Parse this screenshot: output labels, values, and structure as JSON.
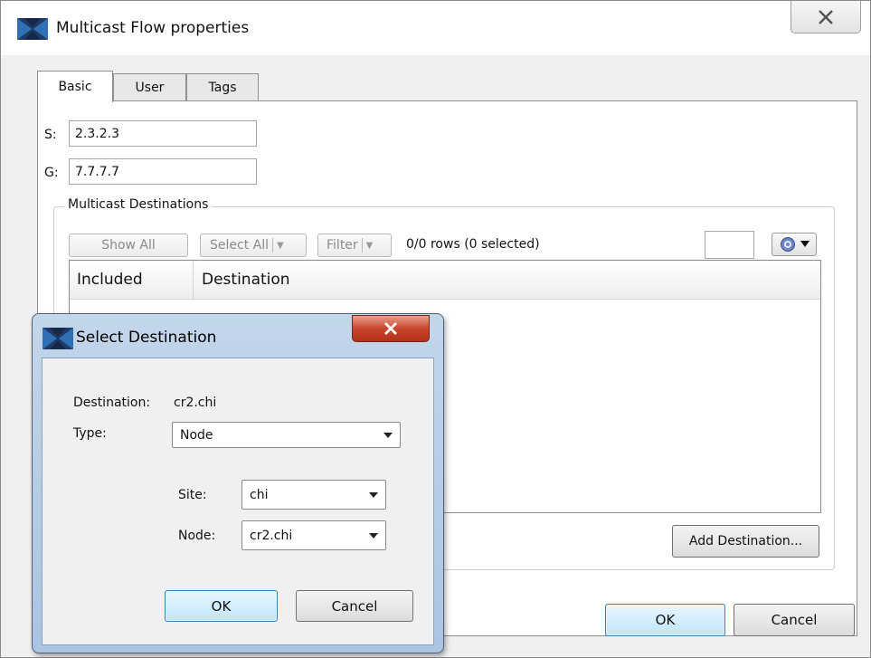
{
  "main_window": {
    "title": "Multicast Flow properties",
    "tabs": [
      "Basic",
      "User",
      "Tags"
    ],
    "s_label": "S:",
    "s_value": "2.3.2.3",
    "g_label": "G:",
    "g_value": "7.7.7.7",
    "group_title": "Multicast Destinations",
    "toolbar": {
      "show_all": "Show All",
      "select_all": "Select All",
      "filter": "Filter",
      "row_status": "0/0 rows (0 selected)"
    },
    "table": {
      "columns": [
        "Included",
        "Destination"
      ],
      "rows": []
    },
    "add_destination": "Add Destination...",
    "ok": "OK",
    "cancel": "Cancel"
  },
  "dialog": {
    "title": "Select Destination",
    "destination_label": "Destination:",
    "destination_value": "cr2.chi",
    "type_label": "Type:",
    "type_value": "Node",
    "site_label": "Site:",
    "site_value": "chi",
    "node_label": "Node:",
    "node_value": "cr2.chi",
    "ok": "OK",
    "cancel": "Cancel"
  },
  "colors": {
    "close_button_red": "#c9462c",
    "default_button_blue": "#bee6fd",
    "dialog_frame": "#aac4e2"
  },
  "icons": [
    "app-logo-icon",
    "close-icon",
    "dropdown-arrow-icon",
    "gear-icon"
  ]
}
